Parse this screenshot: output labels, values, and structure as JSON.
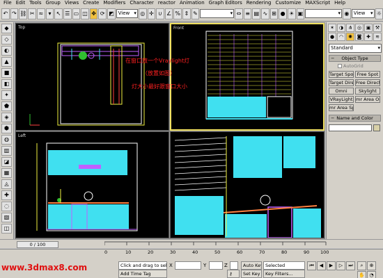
{
  "menu": [
    "File",
    "Edit",
    "Tools",
    "Group",
    "Views",
    "Create",
    "Modifiers",
    "Character",
    "reactor",
    "Animation",
    "Graph Editors",
    "Rendering",
    "Customize",
    "MAXScript",
    "Help"
  ],
  "toolbar": {
    "view_combo_1": "View",
    "view_combo_2": "View"
  },
  "viewports": {
    "top": "Top",
    "front": "Front",
    "left": "Left",
    "perspective": ""
  },
  "annotation": {
    "line1": "在窗口放一个Vraylight灯",
    "line2": "（放置如图）",
    "line3": "灯大小最好跟窗口大小"
  },
  "command_panel": {
    "dropdown": "Standard",
    "object_type_header": "Object Type",
    "autogrid": "AutoGrid",
    "buttons": [
      "Target Spot",
      "Free Spot",
      "Target Direct",
      "Free Direct",
      "Omni",
      "Skylight",
      "VRayLight",
      "mr Area Omni",
      "mr Area Spot",
      ""
    ],
    "name_color_header": "Name and Color"
  },
  "timebar": {
    "slider": "0 / 100",
    "ticks": [
      "0",
      "10",
      "20",
      "30",
      "40",
      "50",
      "60",
      "70",
      "80",
      "90",
      "100"
    ]
  },
  "status": {
    "logo": "www.3dmax8.com",
    "prompt": "Click and drag to select",
    "add_time_tag": "Add Time Tag",
    "x_label": "X",
    "y_label": "Y",
    "z_label": "Z",
    "auto_key": "Auto Key",
    "set_key": "Set Key",
    "selected": "Selected",
    "key_filters": "Key Filters..."
  },
  "colors": {
    "cyan": "#40e0f0",
    "yellow": "#f0f040",
    "magenta": "#c060ff",
    "annotation_red": "#ff2020",
    "logo_red": "#e01010"
  }
}
